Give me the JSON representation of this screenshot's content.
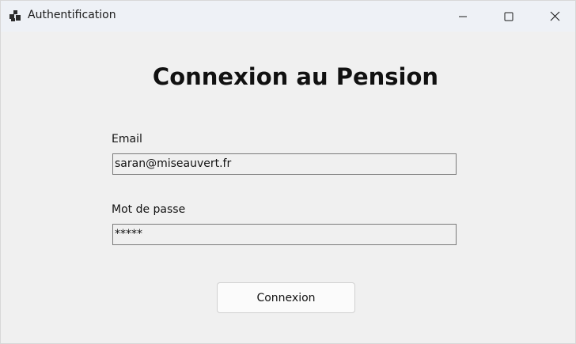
{
  "window": {
    "title": "Authentification",
    "icon": "app-window-icon"
  },
  "controls": {
    "minimize_icon": "minimize-icon",
    "maximize_icon": "maximize-icon",
    "close_icon": "close-icon"
  },
  "form": {
    "heading": "Connexion au Pension",
    "email_label": "Email",
    "email_value": "saran@miseauvert.fr",
    "password_label": "Mot de passe",
    "password_value": "*****",
    "submit_label": "Connexion"
  },
  "colors": {
    "background": "#f0f0f0",
    "titlebar": "#eef1f6",
    "field_border": "#7a7a7a"
  }
}
